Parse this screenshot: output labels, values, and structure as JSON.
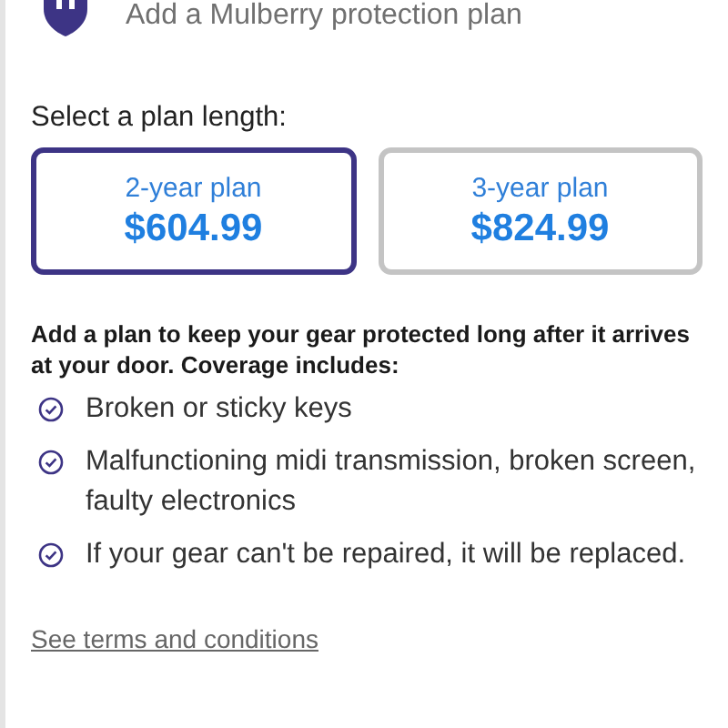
{
  "header": {
    "title": "Add a Mulberry protection plan"
  },
  "plan_prompt": "Select a plan length:",
  "plans": [
    {
      "label": "2-year plan",
      "price": "$604.99",
      "selected": true
    },
    {
      "label": "3-year plan",
      "price": "$824.99",
      "selected": false
    }
  ],
  "description": "Add a plan to keep your gear protected long after it arrives at your door. Coverage includes:",
  "coverage": [
    "Broken or sticky keys",
    "Malfunctioning midi transmission, broken screen, faulty electronics",
    "If your gear can't be repaired, it will be replaced."
  ],
  "terms_link": "See terms and conditions"
}
